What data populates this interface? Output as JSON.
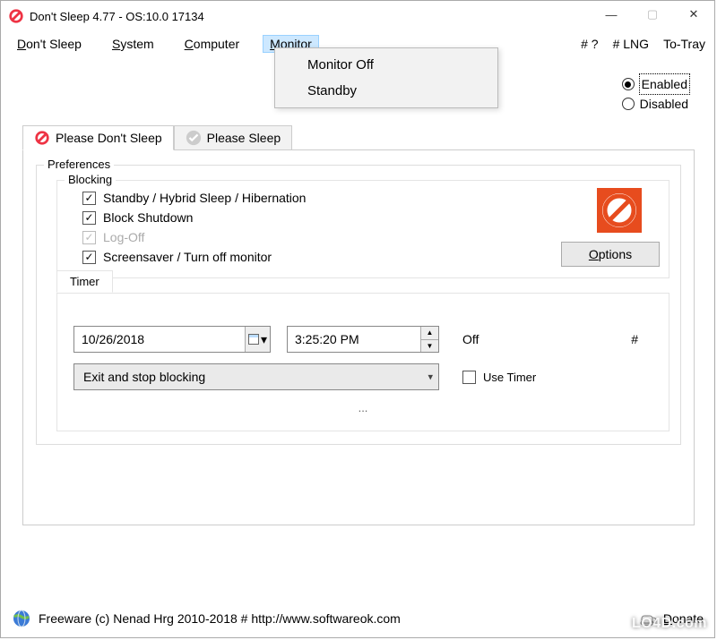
{
  "window": {
    "title": "Don't Sleep 4.77 - OS:10.0 17134"
  },
  "menubar": {
    "dont_sleep": "Don't Sleep",
    "system": "System",
    "computer": "Computer",
    "monitor": "Monitor",
    "hash_q": "# ?",
    "hash_lng": "# LNG",
    "to_tray": "To-Tray"
  },
  "monitor_menu": {
    "off": "Monitor Off",
    "standby": "Standby"
  },
  "enable": {
    "enabled": "Enabled",
    "disabled": "Disabled"
  },
  "tabs": {
    "dont_sleep": "Please Don't Sleep",
    "sleep": "Please Sleep"
  },
  "prefs": {
    "legend": "Preferences",
    "blocking_legend": "Blocking",
    "chk_standby": "Standby / Hybrid Sleep / Hibernation",
    "chk_block_shutdown": "Block Shutdown",
    "chk_logoff": "Log-Off",
    "chk_screensaver": "Screensaver / Turn off monitor",
    "options": "Options"
  },
  "timer": {
    "legend": "Timer",
    "date": "10/26/2018",
    "time": "3:25:20 PM",
    "off": "Off",
    "hash": "#",
    "combo": "Exit and stop blocking",
    "use_timer": "Use Timer",
    "ellipsis": "..."
  },
  "footer": {
    "text": "Freeware (c) Nenad Hrg 2010-2018 # http://www.softwareok.com",
    "donate": "Donate"
  },
  "watermark": "LO4D.com"
}
